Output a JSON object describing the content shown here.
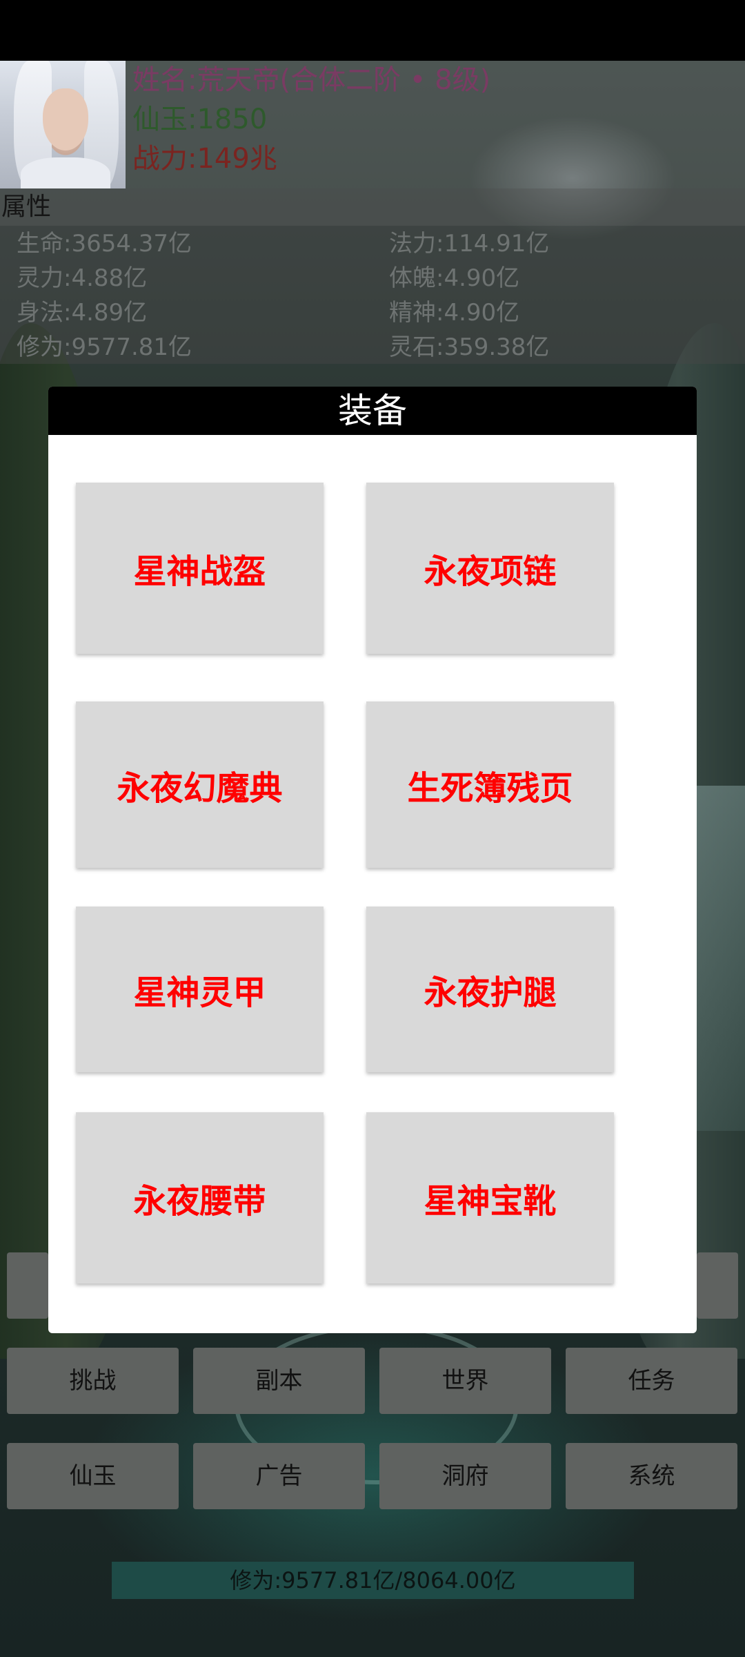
{
  "character": {
    "name_line": "姓名:荒天帝(合体二阶 • 8级)",
    "jade_line": "仙玉:1850",
    "power_line": "战力:149兆"
  },
  "attributes": {
    "title": "属性",
    "items": [
      "生命:3654.37亿",
      "法力:114.91亿",
      "灵力:4.88亿",
      "体魄:4.90亿",
      "身法:4.89亿",
      "精神:4.90亿",
      "修为:9577.81亿",
      "灵石:359.38亿"
    ]
  },
  "equipment_modal": {
    "title": "装备",
    "items": [
      "星神战盔",
      "永夜项链",
      "永夜幻魔典",
      "生死簿残页",
      "星神灵甲",
      "永夜护腿",
      "永夜腰带",
      "星神宝靴"
    ]
  },
  "menu": {
    "row1": [
      "挑战",
      "副本",
      "世界",
      "任务"
    ],
    "row2": [
      "仙玉",
      "广告",
      "洞府",
      "系统"
    ]
  },
  "cultivation_progress": {
    "label": "修为:9577.81亿/8064.00亿"
  },
  "colors": {
    "equip_text": "#ff0000",
    "modal_header": "#000000",
    "menu_button": "#5f6260"
  }
}
